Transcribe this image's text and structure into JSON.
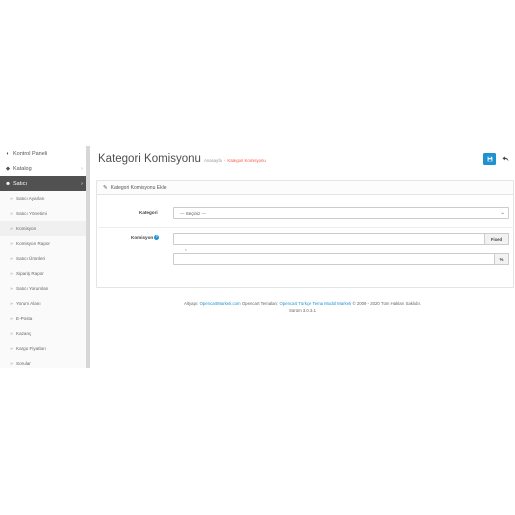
{
  "sidebar": {
    "items": [
      {
        "label": "Kontrol Paneli",
        "icon": "dashboard-icon",
        "glyph": "◐",
        "has_arrow": false
      },
      {
        "label": "Katalog",
        "icon": "tag-icon",
        "glyph": "◆",
        "has_arrow": true
      },
      {
        "label": "Satıcı",
        "icon": "users-icon",
        "glyph": "☻",
        "has_arrow": true,
        "active": true
      }
    ],
    "subitems": [
      {
        "label": "Satıcı Ayarları"
      },
      {
        "label": "Satıcı Yönetimi"
      },
      {
        "label": "Komisyon",
        "current": true
      },
      {
        "label": "Komisyon Rapor"
      },
      {
        "label": "Satıcı Ürünleri"
      },
      {
        "label": "Sipariş Rapor"
      },
      {
        "label": "Satıcı Yorumları"
      },
      {
        "label": "Yorum Alanı"
      },
      {
        "label": "E-Posta"
      },
      {
        "label": "Kazanç"
      },
      {
        "label": "Kargo Fiyatları"
      },
      {
        "label": "Sorular"
      }
    ]
  },
  "header": {
    "title": "Kategori Komisyonu",
    "breadcrumb": [
      "Anasayfa",
      "Kategori Komisyonu"
    ]
  },
  "panel": {
    "heading": "Kategori Komisyonu Ekle",
    "category_label": "Kategori",
    "category_value": "--- Seçiniz ---",
    "commission_label": "Komisyon",
    "fixed_addon": "Fixed",
    "required_marker": "*",
    "percent_addon": "%"
  },
  "footer": {
    "prefix": "Altyapı:",
    "link1": "OpencartMarketi.com",
    "middle": "Opencart Temaları:",
    "link2": "Opencart Türkçe Tema Modül Marketi",
    "suffix": "© 2009 - 2020 Tüm Hakları Saklıdır.",
    "version": "Sürüm 3.0.3.1"
  },
  "colors": {
    "accent": "#1e91cf",
    "breadcrumb_current": "#f05a4a",
    "sidebar_active": "#515151"
  }
}
